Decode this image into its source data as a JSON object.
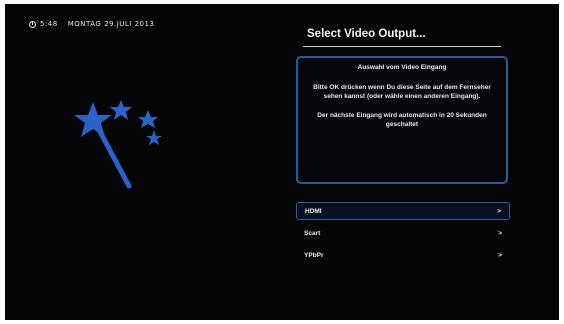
{
  "status_bar": {
    "time": "5:48",
    "date": "MONTAG 29.JULI 2013"
  },
  "wizard": {
    "icon": "magic-wand-stars-icon",
    "colors": {
      "icon_blue": "#2c62c8",
      "panel_border": "#2e5a9e",
      "background": "#050507"
    }
  },
  "panel": {
    "title": "Select Video Output...",
    "info": {
      "heading": "Auswahl vom Video Eingang",
      "text": "Bitte OK drücken wenn Du diese Seite auf dem Fernseher sehen kannst (oder wähle einen anderen Eingang).",
      "next": "Der nächste Eingang wird automatisch in 20 Sekunden geschaltet"
    }
  },
  "menu": {
    "items": [
      {
        "label": "HDMI",
        "arrow": ">",
        "selected": true
      },
      {
        "label": "Scart",
        "arrow": ">",
        "selected": false
      },
      {
        "label": "YPbPr",
        "arrow": ">",
        "selected": false
      }
    ]
  }
}
